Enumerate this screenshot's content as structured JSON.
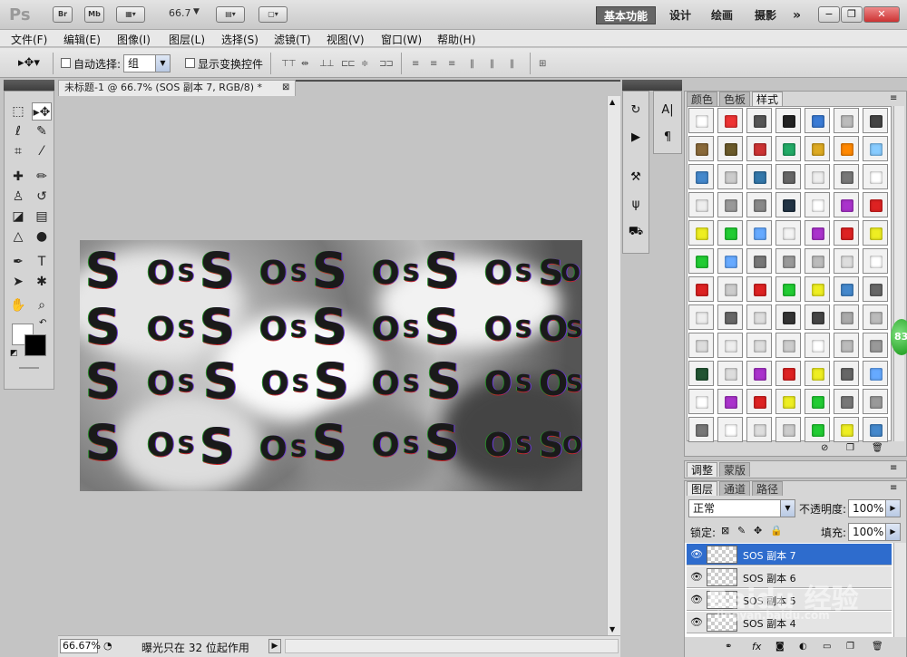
{
  "titlebar": {
    "logo": "Ps",
    "bridge": "Br",
    "minibridge": "Mb",
    "zoom": "66.7",
    "workspaces": [
      "基本功能",
      "设计",
      "绘画",
      "摄影"
    ],
    "more": "»",
    "win_min": "−",
    "win_restore": "❐",
    "win_close": "✕"
  },
  "menu": [
    "文件(F)",
    "编辑(E)",
    "图像(I)",
    "图层(L)",
    "选择(S)",
    "滤镜(T)",
    "视图(V)",
    "窗口(W)",
    "帮助(H)"
  ],
  "options": {
    "auto_select_label": "自动选择:",
    "auto_select_value": "组",
    "show_transform_label": "显示变换控件"
  },
  "document": {
    "tab_title": "未标题-1 @ 66.7% (SOS 副本 7, RGB/8) *",
    "close": "⊠",
    "canvas_text": "S O S"
  },
  "status": {
    "zoom": "66.67%",
    "message": "曝光只在 32 位起作用"
  },
  "styles_panel": {
    "tabs": [
      "颜色",
      "色板",
      "样式"
    ],
    "active_tab": "样式"
  },
  "adjust_panel": {
    "tabs": [
      "调整",
      "蒙版"
    ]
  },
  "layers_panel": {
    "tabs": [
      "图层",
      "通道",
      "路径"
    ],
    "blend_mode": "正常",
    "opacity_label": "不透明度:",
    "opacity": "100%",
    "lock_label": "锁定:",
    "fill_label": "填充:",
    "fill": "100%",
    "layers": [
      {
        "name": "SOS 副本 7",
        "selected": true
      },
      {
        "name": "SOS 副本 6",
        "selected": false
      },
      {
        "name": "SOS 副本 5",
        "selected": false
      },
      {
        "name": "SOS 副本 4",
        "selected": false
      }
    ]
  },
  "badge": "83",
  "watermark": {
    "brand": "Baidu 经验",
    "url": "jingyan.baidu.com"
  },
  "colors": {
    "selected_layer": "#2e6ccd",
    "active_workspace": "#666666"
  }
}
